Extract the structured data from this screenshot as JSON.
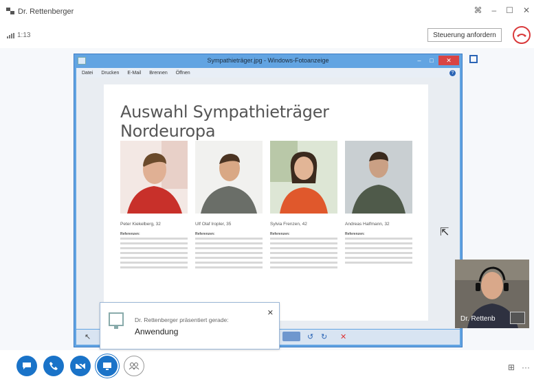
{
  "window": {
    "title": "Dr. Rettenberger",
    "call_duration": "1:13",
    "request_control_label": "Steuerung anfordern"
  },
  "photo_viewer": {
    "title": "Sympathieträger.jpg - Windows-Fotoanzeige",
    "menu": [
      "Datei",
      "Drucken",
      "E-Mail",
      "Brennen",
      "Öffnen"
    ],
    "document": {
      "heading": "Auswahl Sympathieträger Nordeuropa",
      "people": [
        {
          "name": "Peter Kiekelberg, 32",
          "label": "Referenzen:"
        },
        {
          "name": "Ulf Olaf Iropler, 35",
          "label": "Referenzen:"
        },
        {
          "name": "Sylvia Frenzen, 42",
          "label": "Referenzen:"
        },
        {
          "name": "Andreas Halfmann, 32",
          "label": "Referenzen:"
        }
      ]
    }
  },
  "notification": {
    "line1": "Dr. Rettenberger präsentiert gerade:",
    "line2": "Anwendung"
  },
  "self_video": {
    "name": "Dr. Rettenb"
  },
  "colors": {
    "accent": "#1a73c8",
    "hangup": "#d9393b",
    "viewer_frame": "#62a4e2"
  }
}
